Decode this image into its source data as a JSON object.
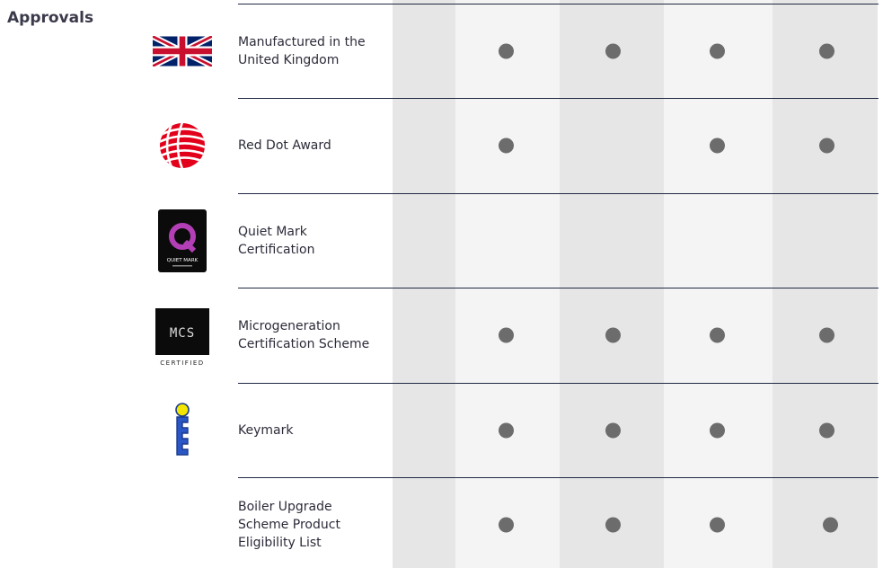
{
  "section": {
    "title": "Approvals"
  },
  "rows": [
    {
      "label": "Manufactured in the\nUnited Kingdom",
      "logo": "uk-flag-icon",
      "marks": [
        true,
        true,
        true,
        true
      ]
    },
    {
      "label": "Red Dot Award",
      "logo": "red-dot-award-icon",
      "marks": [
        true,
        false,
        true,
        true
      ]
    },
    {
      "label": "Quiet Mark\nCertification",
      "logo": "quiet-mark-icon",
      "logo_text": "QUIET MARK",
      "marks": [
        false,
        false,
        false,
        false
      ]
    },
    {
      "label": "Microgeneration\nCertification Scheme",
      "logo": "mcs-certified-icon",
      "logo_text": "MCS",
      "logo_subtext": "CERTIFIED",
      "marks": [
        true,
        true,
        true,
        true
      ]
    },
    {
      "label": "Keymark",
      "logo": "keymark-icon",
      "marks": [
        true,
        true,
        true,
        true
      ]
    },
    {
      "label": "Boiler Upgrade\nScheme Product\nEligibility List",
      "logo": "",
      "marks": [
        true,
        true,
        true,
        true
      ]
    }
  ],
  "colors": {
    "dot": "#6c6c6c",
    "rule": "#1f2a44",
    "shade_dark": "#e6e6e6",
    "shade_light": "#f4f4f4"
  }
}
